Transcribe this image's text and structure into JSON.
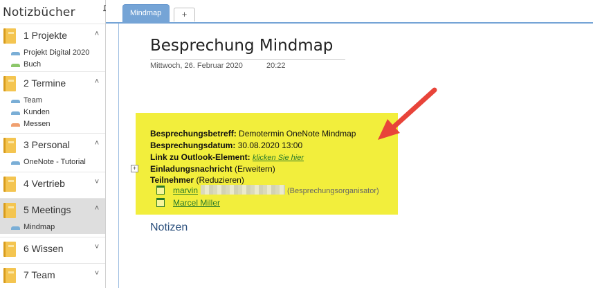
{
  "sidebar": {
    "title": "Notizbücher",
    "pin_icon": "pin-icon",
    "notebooks": [
      {
        "label": "1 Projekte",
        "chevron": "˄",
        "sections": [
          {
            "label": "Projekt Digital 2020",
            "color": "#7aaed6"
          },
          {
            "label": "Buch",
            "color": "#8cc76a"
          }
        ]
      },
      {
        "label": "2 Termine",
        "chevron": "˄",
        "sections": [
          {
            "label": "Team",
            "color": "#7aaed6"
          },
          {
            "label": "Kunden",
            "color": "#7aaed6"
          },
          {
            "label": "Messen",
            "color": "#f0a070"
          }
        ]
      },
      {
        "label": "3 Personal",
        "chevron": "˄",
        "sections": [
          {
            "label": "OneNote - Tutorial",
            "color": "#7aaed6"
          }
        ]
      },
      {
        "label": "4 Vertrieb",
        "chevron": "˅",
        "sections": []
      },
      {
        "label": "5 Meetings",
        "chevron": "˄",
        "active": true,
        "sections": [
          {
            "label": "Mindmap",
            "color": "#7aaed6",
            "active": true
          }
        ]
      },
      {
        "label": "6 Wissen",
        "chevron": "˅",
        "sections": []
      },
      {
        "label": "7 Team",
        "chevron": "˅",
        "sections": []
      }
    ]
  },
  "tabs": {
    "active_label": "Mindmap",
    "add_label": "+"
  },
  "page": {
    "title": "Besprechung Mindmap",
    "date": "Mittwoch, 26. Februar 2020",
    "time": "20:22",
    "notes_heading": "Notizen"
  },
  "meeting": {
    "subject_label": "Besprechungsbetreff:",
    "subject_value": "Demotermin OneNote Mindmap",
    "date_label": "Besprechungsdatum:",
    "date_value": "30.08.2020 13:00",
    "link_label": "Link zu Outlook-Element:",
    "link_text": "klicken Sie hier",
    "invite_label": "Einladungsnachricht",
    "invite_action": "(Erweitern)",
    "participants_label": "Teilnehmer",
    "participants_action": "(Reduzieren)",
    "expand_icon": "+",
    "participants": [
      {
        "name": "marvin",
        "role": "(Besprechungsorganisator)"
      },
      {
        "name": "Marcel Miller",
        "role": ""
      }
    ]
  },
  "colors": {
    "highlight": "#f2ee3c",
    "tab_active": "#75a4d6",
    "arrow": "#e8443a",
    "link": "#2a7a2a"
  }
}
